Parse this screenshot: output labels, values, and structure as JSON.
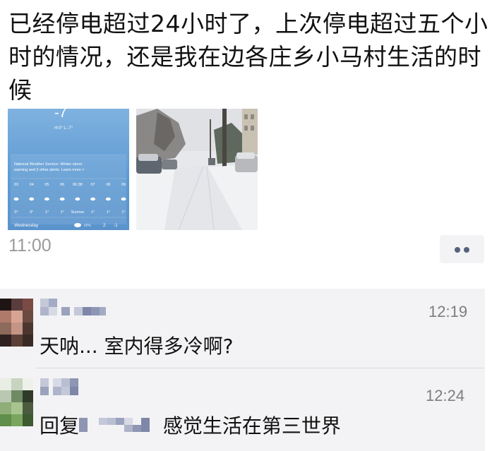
{
  "post": {
    "text": "已经停电超过24小时了，上次停电超过五个小时的情况，还是我在边各庄乡小马村生活的时候",
    "time": "11:00"
  },
  "weather_photo": {
    "temp": "-7",
    "hilo": "H:0° L:-7°",
    "alert": "National Weather Service: Winter storm warning and 2 other alerts. Learn more >",
    "hours": [
      "03",
      "04",
      "05",
      "06",
      "06:38",
      "07",
      "08",
      "09"
    ],
    "temps": [
      "0°",
      "0°",
      "1°",
      "1°",
      "Sunrise",
      "1°",
      "1°",
      "1°"
    ],
    "day": "Wednesday",
    "day_pct": "80%",
    "day_hi": "2",
    "day_lo": "-1"
  },
  "comments": [
    {
      "time": "12:19",
      "text": "天呐... 室内得多冷啊?"
    },
    {
      "time": "12:24",
      "reply_prefix": "回复",
      "text": "感觉生活在第三世界"
    }
  ],
  "colors": {
    "comment_bg": "#f3f3f5",
    "timestamp": "#9a9a9a",
    "more_dots": "#56627a"
  }
}
